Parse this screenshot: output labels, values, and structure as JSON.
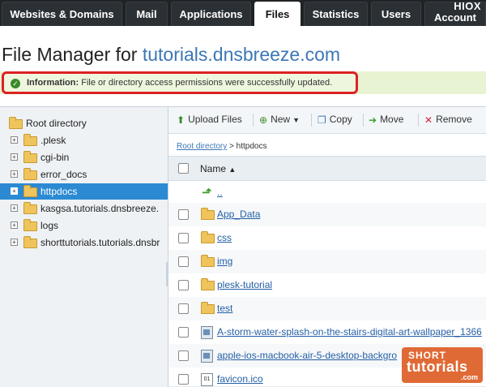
{
  "nav": {
    "tabs": [
      {
        "label": "Websites & Domains",
        "active": false
      },
      {
        "label": "Mail",
        "active": false
      },
      {
        "label": "Applications",
        "active": false
      },
      {
        "label": "Files",
        "active": true
      },
      {
        "label": "Statistics",
        "active": false
      },
      {
        "label": "Users",
        "active": false
      },
      {
        "label": "Account",
        "active": false
      }
    ],
    "brand": "HIOX"
  },
  "page": {
    "title_prefix": "File Manager for ",
    "title_domain": "tutorials.dnsbreeze.com"
  },
  "info": {
    "label": "Information:",
    "text": " File or directory access permissions were successfully updated."
  },
  "tree": {
    "root": "Root directory",
    "items": [
      {
        "label": ".plesk",
        "selected": false
      },
      {
        "label": "cgi-bin",
        "selected": false
      },
      {
        "label": "error_docs",
        "selected": false
      },
      {
        "label": "httpdocs",
        "selected": true
      },
      {
        "label": "kasgsa.tutorials.dnsbreeze.",
        "selected": false
      },
      {
        "label": "logs",
        "selected": false
      },
      {
        "label": "shorttutorials.tutorials.dnsbr",
        "selected": false
      }
    ]
  },
  "toolbar": {
    "upload": "Upload Files",
    "new": "New",
    "copy": "Copy",
    "move": "Move",
    "remove": "Remove"
  },
  "breadcrumb": {
    "root": "Root directory",
    "sep": " > ",
    "current": "httpdocs"
  },
  "table": {
    "header": "Name",
    "sort_indicator": "▲",
    "parent": "..",
    "rows": [
      {
        "type": "folder",
        "name": "App_Data"
      },
      {
        "type": "folder",
        "name": "css"
      },
      {
        "type": "folder",
        "name": "img"
      },
      {
        "type": "folder",
        "name": "plesk-tutorial"
      },
      {
        "type": "folder",
        "name": "test"
      },
      {
        "type": "image",
        "name": "A-storm-water-splash-on-the-stairs-digital-art-wallpaper_1366"
      },
      {
        "type": "image",
        "name": "apple-ios-macbook-air-5-desktop-backgro"
      },
      {
        "type": "ico",
        "name": "favicon.ico"
      }
    ]
  },
  "watermark": {
    "line1": "SHORT",
    "line2": "tutorials",
    "line3": ".com"
  },
  "colors": {
    "accent": "#3c77b5",
    "selected": "#2c8ad3",
    "info_border": "#dd2222",
    "info_bg": "#eef7de"
  }
}
